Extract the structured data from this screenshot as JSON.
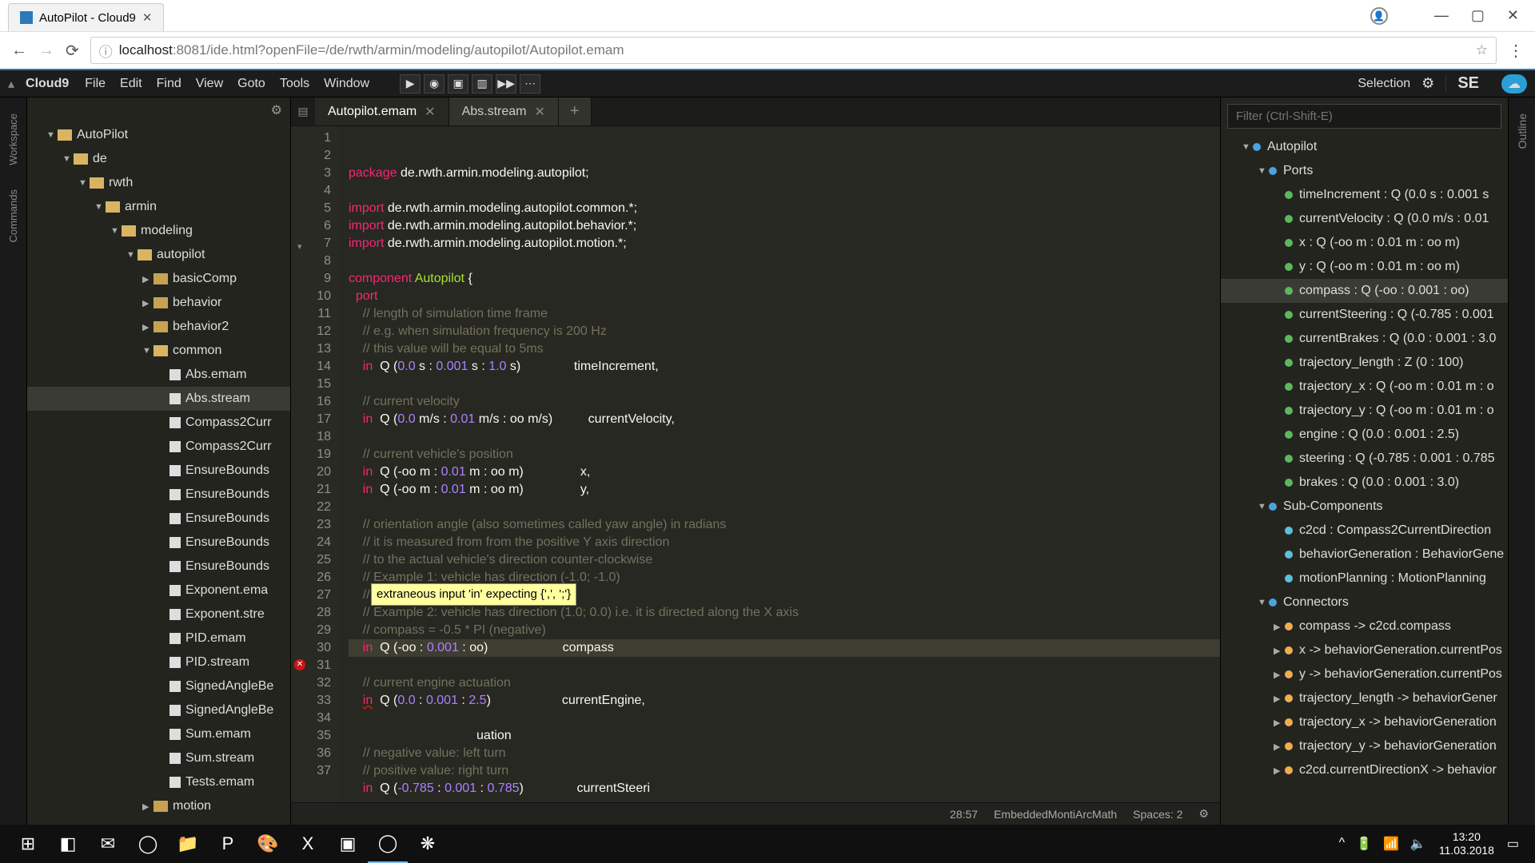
{
  "browser": {
    "tab_title": "AutoPilot - Cloud9",
    "url_host": "localhost",
    "url_rest": ":8081/ide.html?openFile=/de/rwth/armin/modeling/autopilot/Autopilot.emam",
    "info_glyph": "ⓘ"
  },
  "win_controls": {
    "min": "—",
    "max": "▢",
    "close": "✕"
  },
  "menubar": {
    "brand": "Cloud9",
    "items": [
      "File",
      "Edit",
      "Find",
      "View",
      "Goto",
      "Tools",
      "Window"
    ],
    "run_glyphs": [
      "▶",
      "◉",
      "▣",
      "▥",
      "▶▶",
      "⋯"
    ],
    "selection": "Selection",
    "se": "SE"
  },
  "vstrips": {
    "workspace": "Workspace",
    "commands": "Commands",
    "outline": "Outline"
  },
  "tree": [
    {
      "d": 0,
      "t": "folder",
      "open": true,
      "label": "AutoPilot"
    },
    {
      "d": 1,
      "t": "folder",
      "open": true,
      "label": "de"
    },
    {
      "d": 2,
      "t": "folder",
      "open": true,
      "label": "rwth"
    },
    {
      "d": 3,
      "t": "folder",
      "open": true,
      "label": "armin"
    },
    {
      "d": 4,
      "t": "folder",
      "open": true,
      "label": "modeling"
    },
    {
      "d": 5,
      "t": "folder",
      "open": true,
      "label": "autopilot"
    },
    {
      "d": 6,
      "t": "folder",
      "open": false,
      "label": "basicComp"
    },
    {
      "d": 6,
      "t": "folder",
      "open": false,
      "label": "behavior"
    },
    {
      "d": 6,
      "t": "folder",
      "open": false,
      "label": "behavior2"
    },
    {
      "d": 6,
      "t": "folder",
      "open": true,
      "label": "common"
    },
    {
      "d": 7,
      "t": "file",
      "label": "Abs.emam"
    },
    {
      "d": 7,
      "t": "file",
      "label": "Abs.stream",
      "sel": true
    },
    {
      "d": 7,
      "t": "file",
      "label": "Compass2Curr"
    },
    {
      "d": 7,
      "t": "file",
      "label": "Compass2Curr"
    },
    {
      "d": 7,
      "t": "file",
      "label": "EnsureBounds"
    },
    {
      "d": 7,
      "t": "file",
      "label": "EnsureBounds"
    },
    {
      "d": 7,
      "t": "file",
      "label": "EnsureBounds"
    },
    {
      "d": 7,
      "t": "file",
      "label": "EnsureBounds"
    },
    {
      "d": 7,
      "t": "file",
      "label": "EnsureBounds"
    },
    {
      "d": 7,
      "t": "file",
      "label": "Exponent.ema"
    },
    {
      "d": 7,
      "t": "file",
      "label": "Exponent.stre"
    },
    {
      "d": 7,
      "t": "file",
      "label": "PID.emam"
    },
    {
      "d": 7,
      "t": "file",
      "label": "PID.stream"
    },
    {
      "d": 7,
      "t": "file",
      "label": "SignedAngleBe"
    },
    {
      "d": 7,
      "t": "file",
      "label": "SignedAngleBe"
    },
    {
      "d": 7,
      "t": "file",
      "label": "Sum.emam"
    },
    {
      "d": 7,
      "t": "file",
      "label": "Sum.stream"
    },
    {
      "d": 7,
      "t": "file",
      "label": "Tests.emam"
    },
    {
      "d": 6,
      "t": "folder",
      "open": false,
      "label": "motion"
    }
  ],
  "tabs": [
    {
      "label": "Autopilot.emam",
      "active": true
    },
    {
      "label": "Abs.stream",
      "active": false
    }
  ],
  "code_lines": [
    {
      "n": 1,
      "html": "<span class='kw'>package</span> de.rwth.armin.modeling.autopilot;"
    },
    {
      "n": 2,
      "html": ""
    },
    {
      "n": 3,
      "html": "<span class='kw'>import</span> de.rwth.armin.modeling.autopilot.common.*;"
    },
    {
      "n": 4,
      "html": "<span class='kw'>import</span> de.rwth.armin.modeling.autopilot.behavior.*;"
    },
    {
      "n": 5,
      "html": "<span class='kw'>import</span> de.rwth.armin.modeling.autopilot.motion.*;"
    },
    {
      "n": 6,
      "html": ""
    },
    {
      "n": 7,
      "fold": true,
      "html": "<span class='kw'>component</span> <span class='fn'>Autopilot</span> {"
    },
    {
      "n": 8,
      "html": "  <span class='kw'>port</span>"
    },
    {
      "n": 9,
      "html": "    <span class='cm'>// length of simulation time frame</span>"
    },
    {
      "n": 10,
      "html": "    <span class='cm'>// e.g. when simulation frequency is 200 Hz</span>"
    },
    {
      "n": 11,
      "html": "    <span class='cm'>// this value will be equal to 5ms</span>"
    },
    {
      "n": 12,
      "html": "    <span class='kw'>in</span>  Q (<span class='num'>0.0</span> s : <span class='num'>0.001</span> s : <span class='num'>1.0</span> s)               timeIncrement,"
    },
    {
      "n": 13,
      "html": ""
    },
    {
      "n": 14,
      "html": "    <span class='cm'>// current velocity</span>"
    },
    {
      "n": 15,
      "html": "    <span class='kw'>in</span>  Q (<span class='num'>0.0</span> m/s : <span class='num'>0.01</span> m/s : oo m/s)          currentVelocity,"
    },
    {
      "n": 16,
      "html": ""
    },
    {
      "n": 17,
      "html": "    <span class='cm'>// current vehicle's position</span>"
    },
    {
      "n": 18,
      "html": "    <span class='kw'>in</span>  Q (-oo m : <span class='num'>0.01</span> m : oo m)                x,"
    },
    {
      "n": 19,
      "html": "    <span class='kw'>in</span>  Q (-oo m : <span class='num'>0.01</span> m : oo m)                y,"
    },
    {
      "n": 20,
      "html": ""
    },
    {
      "n": 21,
      "html": "    <span class='cm'>// orientation angle (also sometimes called yaw angle) in radians</span>"
    },
    {
      "n": 22,
      "html": "    <span class='cm'>// it is measured from from the positive Y axis direction</span>"
    },
    {
      "n": 23,
      "html": "    <span class='cm'>// to the actual vehicle's direction counter-clockwise</span>"
    },
    {
      "n": 24,
      "html": "    <span class='cm'>// Example 1: vehicle has direction (-1.0; -1.0)</span>"
    },
    {
      "n": 25,
      "html": "    <span class='cm'>// compass = 0.25 * PI (positive)</span>"
    },
    {
      "n": 26,
      "html": "    <span class='cm'>// Example 2: vehicle has direction (1.0; 0.0) i.e. it is directed along the X axis</span>"
    },
    {
      "n": 27,
      "html": "    <span class='cm'>// compass = -0.5 * PI (negative)</span>"
    },
    {
      "n": 28,
      "hl": true,
      "html": "    <span class='kw'>in</span>  Q (-oo : <span class='num'>0.001</span> : oo)                     compass"
    },
    {
      "n": 29,
      "html": ""
    },
    {
      "n": 30,
      "html": "    <span class='cm'>// current engine actuation</span>"
    },
    {
      "n": 31,
      "err": true,
      "html": "    <span class='kw err-u'>in</span>  Q (<span class='num'>0.0</span> : <span class='num'>0.001</span> : <span class='num'>2.5</span>)                    currentEngine,"
    },
    {
      "n": 32,
      "html": ""
    },
    {
      "n": 33,
      "html": "                                    uation"
    },
    {
      "n": 34,
      "html": "    <span class='cm'>// negative value: left turn</span>"
    },
    {
      "n": 35,
      "html": "    <span class='cm'>// positive value: right turn</span>"
    },
    {
      "n": 36,
      "html": "    <span class='kw'>in</span>  Q (<span class='num'>-0.785</span> : <span class='num'>0.001</span> : <span class='num'>0.785</span>)               currentSteeri"
    },
    {
      "n": 37,
      "html": ""
    }
  ],
  "tooltip": "extraneous input 'in' expecting {',', ';'}",
  "statusbar": {
    "pos": "28:57",
    "lang": "EmbeddedMontiArcMath",
    "spaces": "Spaces: 2"
  },
  "outline_filter_placeholder": "Filter (Ctrl-Shift-E)",
  "outline": [
    {
      "d": 0,
      "arrow": "▼",
      "dot": "blue",
      "label": "Autopilot"
    },
    {
      "d": 1,
      "arrow": "▼",
      "dot": "blue",
      "label": "Ports"
    },
    {
      "d": 2,
      "dot": "green",
      "label": "timeIncrement : Q (0.0 s : 0.001 s"
    },
    {
      "d": 2,
      "dot": "green",
      "label": "currentVelocity : Q (0.0 m/s : 0.01"
    },
    {
      "d": 2,
      "dot": "green",
      "label": "x : Q (-oo m : 0.01 m : oo m)"
    },
    {
      "d": 2,
      "dot": "green",
      "label": "y : Q (-oo m : 0.01 m : oo m)"
    },
    {
      "d": 2,
      "dot": "green",
      "label": "compass : Q (-oo : 0.001 : oo)",
      "sel": true
    },
    {
      "d": 2,
      "dot": "green",
      "label": "currentSteering : Q (-0.785 : 0.001"
    },
    {
      "d": 2,
      "dot": "green",
      "label": "currentBrakes : Q (0.0 : 0.001 : 3.0"
    },
    {
      "d": 2,
      "dot": "green",
      "label": "trajectory_length : Z (0 : 100)"
    },
    {
      "d": 2,
      "dot": "green",
      "label": "trajectory_x : Q (-oo m : 0.01 m : o"
    },
    {
      "d": 2,
      "dot": "green",
      "label": "trajectory_y : Q (-oo m : 0.01 m : o"
    },
    {
      "d": 2,
      "dot": "green",
      "label": "engine : Q (0.0 : 0.001 : 2.5)"
    },
    {
      "d": 2,
      "dot": "green",
      "label": "steering : Q (-0.785 : 0.001 : 0.785"
    },
    {
      "d": 2,
      "dot": "green",
      "label": "brakes : Q (0.0 : 0.001 : 3.0)"
    },
    {
      "d": 1,
      "arrow": "▼",
      "dot": "blue",
      "label": "Sub-Components"
    },
    {
      "d": 2,
      "dot": "cyan",
      "label": "c2cd : Compass2CurrentDirection"
    },
    {
      "d": 2,
      "dot": "cyan",
      "label": "behaviorGeneration : BehaviorGene"
    },
    {
      "d": 2,
      "dot": "cyan",
      "label": "motionPlanning : MotionPlanning"
    },
    {
      "d": 1,
      "arrow": "▼",
      "dot": "blue",
      "label": "Connectors"
    },
    {
      "d": 2,
      "arrow": "▶",
      "dot": "orange",
      "label": "compass -> c2cd.compass"
    },
    {
      "d": 2,
      "arrow": "▶",
      "dot": "orange",
      "label": "x -> behaviorGeneration.currentPos"
    },
    {
      "d": 2,
      "arrow": "▶",
      "dot": "orange",
      "label": "y -> behaviorGeneration.currentPos"
    },
    {
      "d": 2,
      "arrow": "▶",
      "dot": "orange",
      "label": "trajectory_length -> behaviorGener"
    },
    {
      "d": 2,
      "arrow": "▶",
      "dot": "orange",
      "label": "trajectory_x -> behaviorGeneration"
    },
    {
      "d": 2,
      "arrow": "▶",
      "dot": "orange",
      "label": "trajectory_y -> behaviorGeneration"
    },
    {
      "d": 2,
      "arrow": "▶",
      "dot": "orange",
      "label": "c2cd.currentDirectionX -> behavior"
    }
  ],
  "taskbar": {
    "apps": [
      "⊞",
      "◧",
      "✉",
      "◯",
      "📁",
      "P",
      "🎨",
      "X",
      "▣",
      "◯",
      "❋"
    ],
    "tray": [
      "^",
      "🔋",
      "📶",
      "🔈"
    ],
    "time": "13:20",
    "date": "11.03.2018"
  }
}
